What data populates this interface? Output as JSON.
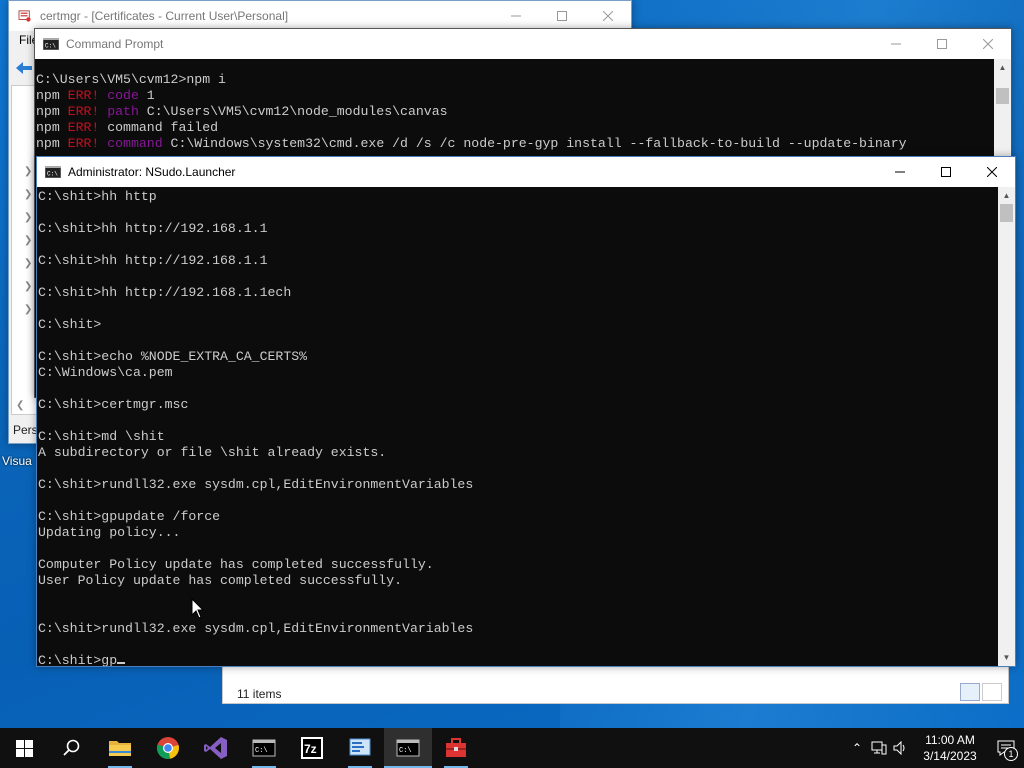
{
  "certmgr": {
    "title": "certmgr - [Certificates - Current User\\Personal]",
    "menu_first": "File",
    "status": "Pers",
    "desktop_label": "Visua"
  },
  "explorer": {
    "item_count": "11 items"
  },
  "cmd_back": {
    "title": "Command Prompt",
    "lines": [
      [
        {
          "t": "C:\\Users\\VM5\\cvm12>npm i",
          "c": ""
        }
      ],
      [
        {
          "t": "npm ",
          "c": ""
        },
        {
          "t": "ERR!",
          "c": "err"
        },
        {
          "t": " ",
          "c": ""
        },
        {
          "t": "code",
          "c": "npm-key"
        },
        {
          "t": " 1",
          "c": ""
        }
      ],
      [
        {
          "t": "npm ",
          "c": ""
        },
        {
          "t": "ERR!",
          "c": "err"
        },
        {
          "t": " ",
          "c": ""
        },
        {
          "t": "path",
          "c": "npm-key"
        },
        {
          "t": " C:\\Users\\VM5\\cvm12\\node_modules\\canvas",
          "c": ""
        }
      ],
      [
        {
          "t": "npm ",
          "c": ""
        },
        {
          "t": "ERR!",
          "c": "err"
        },
        {
          "t": " command failed",
          "c": ""
        }
      ],
      [
        {
          "t": "npm ",
          "c": ""
        },
        {
          "t": "ERR!",
          "c": "err"
        },
        {
          "t": " ",
          "c": ""
        },
        {
          "t": "command",
          "c": "npm-key"
        },
        {
          "t": " C:\\Windows\\system32\\cmd.exe /d /s /c node-pre-gyp install --fallback-to-build --update-binary",
          "c": ""
        }
      ]
    ]
  },
  "cmd_front": {
    "title": "Administrator: NSudo.Launcher",
    "lines": [
      "C:\\shit>hh http",
      "",
      "C:\\shit>hh http://192.168.1.1",
      "",
      "C:\\shit>hh http://192.168.1.1",
      "",
      "C:\\shit>hh http://192.168.1.1ech",
      "",
      "C:\\shit>",
      "",
      "C:\\shit>echo %NODE_EXTRA_CA_CERTS%",
      "C:\\Windows\\ca.pem",
      "",
      "C:\\shit>certmgr.msc",
      "",
      "C:\\shit>md \\shit",
      "A subdirectory or file \\shit already exists.",
      "",
      "C:\\shit>rundll32.exe sysdm.cpl,EditEnvironmentVariables",
      "",
      "C:\\shit>gpupdate /force",
      "Updating policy...",
      "",
      "Computer Policy update has completed successfully.",
      "User Policy update has completed successfully.",
      "",
      "",
      "C:\\shit>rundll32.exe sysdm.cpl,EditEnvironmentVariables",
      "",
      "C:\\shit>gp"
    ]
  },
  "taskbar": {
    "items": [
      {
        "name": "start-button",
        "icon": "windows-icon"
      },
      {
        "name": "search-button",
        "icon": "search-icon"
      },
      {
        "name": "file-explorer-button",
        "icon": "folder-icon"
      },
      {
        "name": "chrome-button",
        "icon": "chrome-icon"
      },
      {
        "name": "visual-studio-button",
        "icon": "visual-studio-icon"
      },
      {
        "name": "command-prompt-button",
        "icon": "cmd-icon"
      },
      {
        "name": "7zip-button",
        "icon": "7zip-icon"
      },
      {
        "name": "server-manager-button",
        "icon": "server-icon"
      },
      {
        "name": "command-prompt-admin-button",
        "icon": "cmd-icon"
      },
      {
        "name": "toolbox-button",
        "icon": "toolbox-icon"
      }
    ],
    "time": "11:00 AM",
    "date": "3/14/2023",
    "notification_count": "1"
  }
}
